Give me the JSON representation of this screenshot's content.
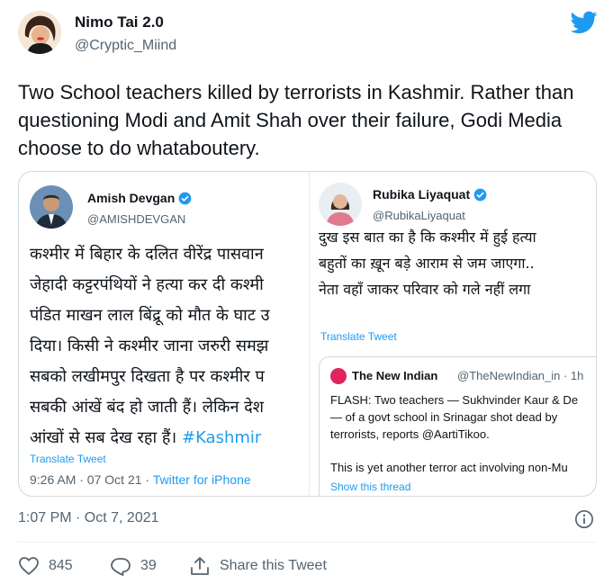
{
  "author": {
    "name": "Nimo Tai 2.0",
    "handle": "@Cryptic_Miind"
  },
  "tweet_text": "Two School teachers killed by terrorists in Kashmir. Rather than questioning Modi and Amit Shah over their failure, Godi Media choose to do whataboutery.",
  "embedded_left": {
    "name": "Amish Devgan",
    "handle": "@AMISHDEVGAN",
    "lines": [
      "कश्मीर में बिहार के दलित वीरेंद्र पासवान",
      "जेहादी कट्टरपंथियों ने हत्या कर दी कश्मी",
      "पंडित माखन लाल बिंद्रू को मौत के घाट उ",
      "दिया। किसी ने कश्मीर जाना जरुरी समझ",
      "सबको लखीमपुर दिखता है पर कश्मीर प",
      "सबकी आंखें बंद हो जाती हैं। लेकिन देश"
    ],
    "last_line": "आंखों से सब देख रहा हैं।",
    "hashtag": "#Kashmir",
    "translate": "Translate Tweet",
    "time": "9:26 AM · 07 Oct 21 ·",
    "source": "Twitter for iPhone"
  },
  "embedded_right": {
    "name": "Rubika Liyaquat",
    "handle": "@RubikaLiyaquat",
    "lines": [
      "दुख इस बात का है कि कश्मीर में हुई हत्या",
      "बहुतों का ख़ून बड़े आराम से जम जाएगा..",
      "नेता वहाँ जाकर परिवार को गले नहीं लगा"
    ],
    "translate": "Translate Tweet",
    "quote": {
      "name": "The New Indian",
      "handle": "@TheNewIndian_in · 1h",
      "lines": [
        "FLASH: Two teachers — Sukhvinder Kaur & De",
        "— of a govt school in Srinagar shot dead by",
        "terrorists, reports @AartiTikoo."
      ],
      "extra": "This is yet another terror act involving non-Mu",
      "show_thread": "Show this thread"
    }
  },
  "timestamp": "1:07 PM · Oct 7, 2021",
  "actions": {
    "likes": "845",
    "replies": "39",
    "share": "Share this Tweet"
  },
  "colors": {
    "accent": "#1d9bf0",
    "text": "#0f1419",
    "muted": "#536471",
    "border": "#cfd9de"
  },
  "icons": [
    "twitter-bird-icon",
    "verified-badge-icon",
    "info-icon",
    "heart-icon",
    "reply-icon",
    "share-icon"
  ]
}
